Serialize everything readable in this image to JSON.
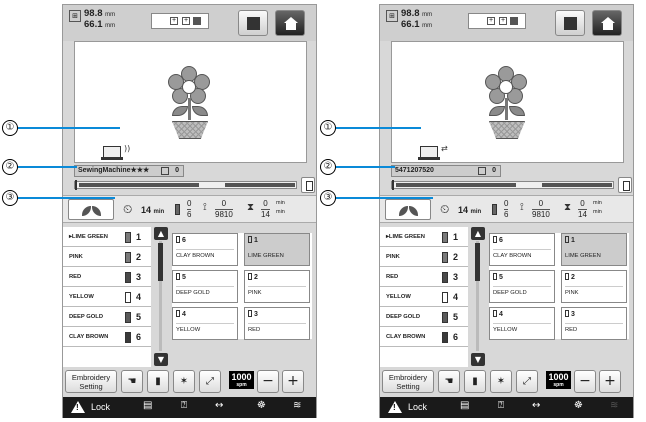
{
  "callouts": [
    "①",
    "②",
    "③"
  ],
  "screens": [
    {
      "width_value": "98.8",
      "height_value": "66.1",
      "unit": "mm",
      "machine_name": "SewingMachine★★★",
      "stitch_count": "0",
      "total_time": "14",
      "time_unit": "min",
      "color_count_done": "0",
      "color_count_total": "6",
      "stitch_done": "0",
      "stitch_total": "9810",
      "time_done": "0",
      "time_total": "14",
      "thread_list": [
        {
          "label": "▸LIME GREEN",
          "num": "1",
          "color": "#7a7a7a"
        },
        {
          "label": "PINK",
          "num": "2",
          "color": "#7a7a7a"
        },
        {
          "label": "RED",
          "num": "3",
          "color": "#4a4a4a"
        },
        {
          "label": "YELLOW",
          "num": "4",
          "color": "#ffffff"
        },
        {
          "label": "DEEP GOLD",
          "num": "5",
          "color": "#5a5a5a"
        },
        {
          "label": "CLAY BROWN",
          "num": "6",
          "color": "#3a3a3a"
        }
      ],
      "grid_cells": [
        {
          "num": "6",
          "name": "CLAY BROWN",
          "selected": false
        },
        {
          "num": "1",
          "name": "LIME GREEN",
          "selected": true
        },
        {
          "num": "5",
          "name": "DEEP GOLD",
          "selected": false
        },
        {
          "num": "2",
          "name": "PINK",
          "selected": false
        },
        {
          "num": "4",
          "name": "YELLOW",
          "selected": false
        },
        {
          "num": "3",
          "name": "RED",
          "selected": false
        }
      ],
      "embroidery_setting": "Embroidery Setting",
      "speed": "1000",
      "speed_unit": "spm",
      "lock_label": "Lock",
      "minus": "−",
      "plus": "+"
    },
    {
      "width_value": "98.8",
      "height_value": "66.1",
      "unit": "mm",
      "machine_name": "5471207520",
      "stitch_count": "0",
      "total_time": "14",
      "time_unit": "min",
      "color_count_done": "0",
      "color_count_total": "6",
      "stitch_done": "0",
      "stitch_total": "9810",
      "time_done": "0",
      "time_total": "14",
      "thread_list": [
        {
          "label": "▸LIME GREEN",
          "num": "1",
          "color": "#7a7a7a"
        },
        {
          "label": "PINK",
          "num": "2",
          "color": "#7a7a7a"
        },
        {
          "label": "RED",
          "num": "3",
          "color": "#4a4a4a"
        },
        {
          "label": "YELLOW",
          "num": "4",
          "color": "#ffffff"
        },
        {
          "label": "DEEP GOLD",
          "num": "5",
          "color": "#5a5a5a"
        },
        {
          "label": "CLAY BROWN",
          "num": "6",
          "color": "#3a3a3a"
        }
      ],
      "grid_cells": [
        {
          "num": "6",
          "name": "CLAY BROWN",
          "selected": false
        },
        {
          "num": "1",
          "name": "LIME GREEN",
          "selected": true
        },
        {
          "num": "5",
          "name": "DEEP GOLD",
          "selected": false
        },
        {
          "num": "2",
          "name": "PINK",
          "selected": false
        },
        {
          "num": "4",
          "name": "YELLOW",
          "selected": false
        },
        {
          "num": "3",
          "name": "RED",
          "selected": false
        }
      ],
      "embroidery_setting": "Embroidery Setting",
      "speed": "1000",
      "speed_unit": "spm",
      "lock_label": "Lock",
      "minus": "−",
      "plus": "+"
    }
  ]
}
